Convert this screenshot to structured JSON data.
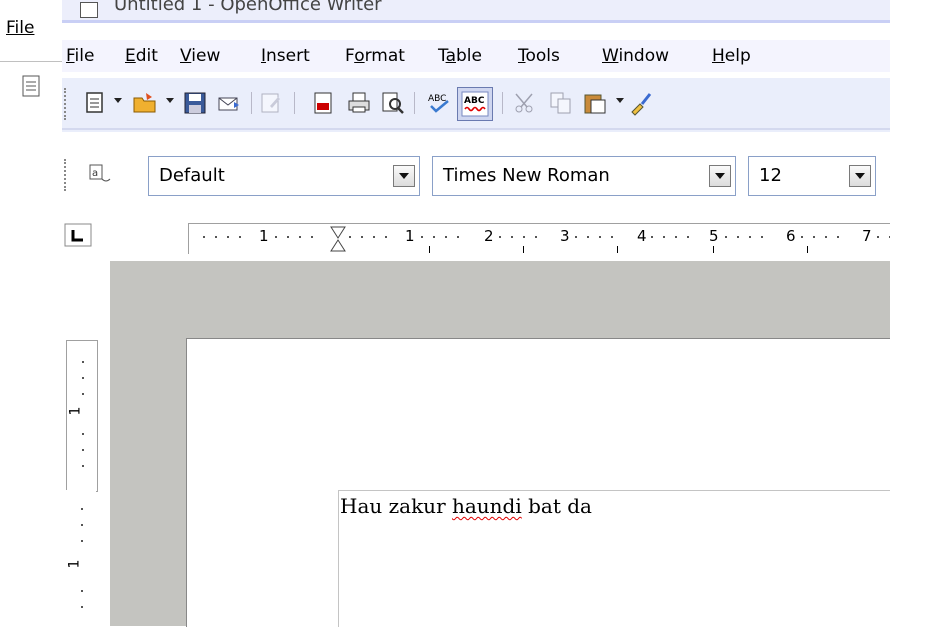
{
  "window": {
    "title": "Untitled 1 - OpenOffice Writer"
  },
  "background_app": {
    "menu_label": "File"
  },
  "menu": [
    {
      "label": "File"
    },
    {
      "label": "Edit"
    },
    {
      "label": "View"
    },
    {
      "label": "Insert"
    },
    {
      "label": "Format"
    },
    {
      "label": "Table"
    },
    {
      "label": "Tools"
    },
    {
      "label": "Window"
    },
    {
      "label": "Help"
    }
  ],
  "toolbar": {
    "icons": [
      "new-document-icon",
      "open-folder-icon",
      "save-disk-icon",
      "email-icon",
      "edit-file-icon",
      "export-pdf-icon",
      "print-icon",
      "page-preview-icon",
      "spellcheck-icon",
      "autospellcheck-icon",
      "cut-icon",
      "copy-icon",
      "paste-icon",
      "clone-formatting-icon"
    ]
  },
  "format_bar": {
    "paragraph_style": "Default",
    "font_name": "Times New Roman",
    "font_size": "12"
  },
  "ruler": {
    "labels": [
      "1",
      "1",
      "2",
      "3",
      "4",
      "5",
      "6",
      "7"
    ]
  },
  "vruler": {
    "labels": [
      "1",
      "1"
    ]
  },
  "document": {
    "words": [
      "Hau zakur ",
      "haundi",
      " bat da"
    ]
  },
  "colors": {
    "spell_error": "#e00000",
    "toolbar_bg": "#eaeefb",
    "page_bg": "#c4c4c0"
  }
}
